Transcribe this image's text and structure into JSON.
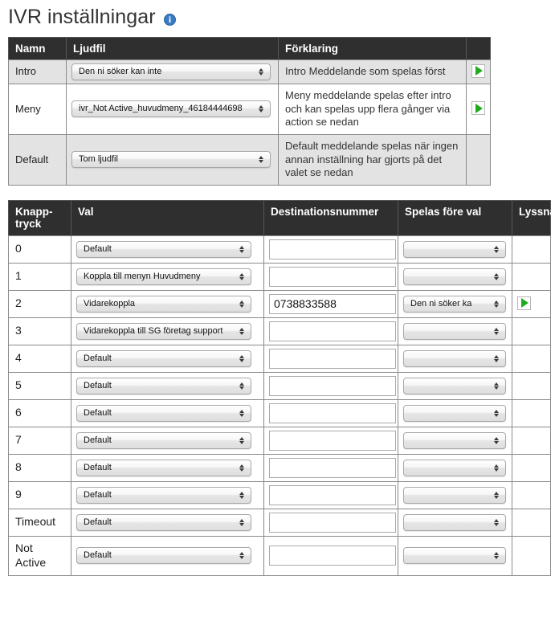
{
  "header": {
    "title": "IVR inställningar",
    "info_icon": "info-circle-icon"
  },
  "audio_table": {
    "columns": [
      "Namn",
      "Ljudfil",
      "Förklaring",
      ""
    ],
    "rows": [
      {
        "name": "Intro",
        "audio_file": "Den ni söker kan inte",
        "description": "Intro Meddelande som spelas först",
        "has_play": true,
        "play_icon": "play-icon"
      },
      {
        "name": "Meny",
        "audio_file": "ivr_Not Active_huvudmeny_46184444698",
        "description": "Meny meddelande spelas efter intro och kan spelas upp flera gånger via action se nedan",
        "has_play": true,
        "play_icon": "play-icon"
      },
      {
        "name": "Default",
        "audio_file": "Tom ljudfil",
        "description": "Default meddelande spelas när ingen annan inställning har gjorts på det valet se nedan",
        "has_play": false,
        "play_icon": "play-icon"
      }
    ]
  },
  "keys_table": {
    "columns": [
      "Knapp-tryck",
      "Val",
      "Destinationsnummer",
      "Spelas före val",
      "Lyssna"
    ],
    "rows": [
      {
        "key": "0",
        "choice": "Default",
        "destination": "",
        "play_before": "",
        "has_play": false
      },
      {
        "key": "1",
        "choice": "Koppla till menyn Huvudmeny",
        "destination": "",
        "play_before": "",
        "has_play": false
      },
      {
        "key": "2",
        "choice": "Vidarekoppla",
        "destination": "0738833588",
        "play_before": "Den ni söker ka",
        "has_play": true
      },
      {
        "key": "3",
        "choice": "Vidarekoppla till SG företag support",
        "destination": "",
        "play_before": "",
        "has_play": false
      },
      {
        "key": "4",
        "choice": "Default",
        "destination": "",
        "play_before": "",
        "has_play": false
      },
      {
        "key": "5",
        "choice": "Default",
        "destination": "",
        "play_before": "",
        "has_play": false
      },
      {
        "key": "6",
        "choice": "Default",
        "destination": "",
        "play_before": "",
        "has_play": false
      },
      {
        "key": "7",
        "choice": "Default",
        "destination": "",
        "play_before": "",
        "has_play": false
      },
      {
        "key": "8",
        "choice": "Default",
        "destination": "",
        "play_before": "",
        "has_play": false
      },
      {
        "key": "9",
        "choice": "Default",
        "destination": "",
        "play_before": "",
        "has_play": false
      },
      {
        "key": "Timeout",
        "choice": "Default",
        "destination": "",
        "play_before": "",
        "has_play": false
      },
      {
        "key": "Not Active",
        "choice": "Default",
        "destination": "",
        "play_before": "",
        "has_play": false
      }
    ]
  },
  "colors": {
    "header_bg": "#2f2f2f",
    "alt_row_bg": "#e3e3e3",
    "play_green": "#1faa1f",
    "info_blue": "#3a7cc4",
    "title_text": "#333333"
  }
}
